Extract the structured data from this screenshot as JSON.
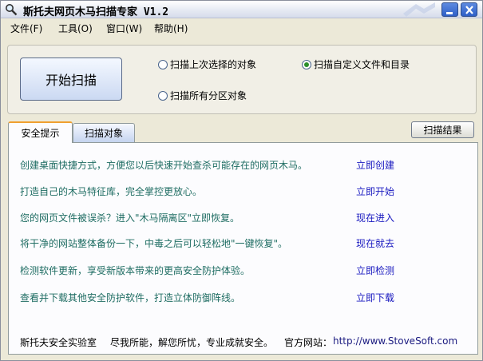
{
  "window": {
    "title": "斯托夫网页木马扫描专家 V1.2"
  },
  "menu": {
    "items": [
      {
        "label": "文件(F)"
      },
      {
        "label": "工具(O)"
      },
      {
        "label": "窗口(W)"
      },
      {
        "label": "帮助(H)"
      }
    ]
  },
  "scan": {
    "start_label": "开始扫描",
    "options": [
      {
        "label": "扫描上次选择的对象",
        "selected": false
      },
      {
        "label": "扫描自定义文件和目录",
        "selected": true
      },
      {
        "label": "扫描所有分区对象",
        "selected": false
      }
    ]
  },
  "tabs": {
    "active": "安全提示",
    "inactive": "扫描对象",
    "results_label": "扫描结果"
  },
  "tips": [
    {
      "text": "创建桌面快捷方式，方便您以后快速开始查杀可能存在的网页木马。",
      "link": "立即创建"
    },
    {
      "text": "打造自己的木马特征库，完全掌控更放心。",
      "link": "立即开始"
    },
    {
      "text": "您的网页文件被误杀？进入\"木马隔离区\"立即恢复。",
      "link": "现在进入"
    },
    {
      "text": "将干净的网站整体备份一下，中毒之后可以轻松地\"一键恢复\"。",
      "link": "现在就去"
    },
    {
      "text": "检测软件更新，享受新版本带来的更高安全防护体验。",
      "link": "立即检测"
    },
    {
      "text": "查看并下载其他安全防护软件，打造立体防御阵线。",
      "link": "立即下载"
    }
  ],
  "footer": {
    "lab": "斯托夫安全实验室",
    "slogan": "尽我所能，解您所忧，专业成就安全。",
    "site_label": "官方网站：",
    "site_url": "http://www.StoveSoft.com"
  },
  "colors": {
    "tip_text": "#1f6d63",
    "link": "#1a1ac0",
    "title_button": "#2e5fc7"
  }
}
